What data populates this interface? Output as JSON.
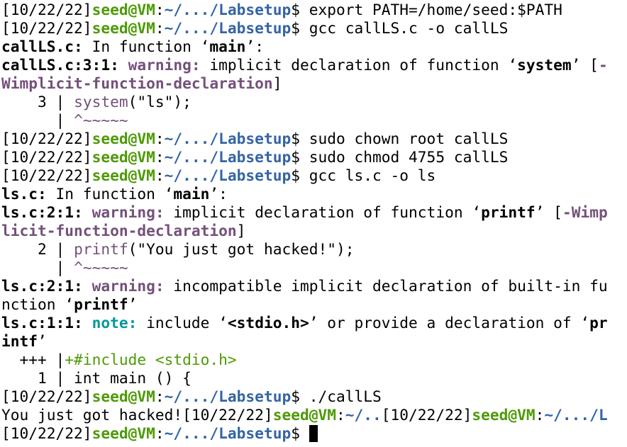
{
  "prompt": {
    "date": "[10/22/22]",
    "user": "seed@VM",
    "colon": ":",
    "path": "~/.../Labsetup",
    "dollar": "$ "
  },
  "lines": [
    {
      "type": "prompt",
      "cmd": "export PATH=/home/seed:$PATH"
    },
    {
      "type": "prompt",
      "cmd": "gcc callLS.c -o callLS"
    },
    {
      "type": "text",
      "segments": [
        {
          "t": "callLS.c:",
          "c": "b"
        },
        {
          "t": " In function ‘",
          "c": ""
        },
        {
          "t": "main",
          "c": "b"
        },
        {
          "t": "’:",
          "c": ""
        }
      ]
    },
    {
      "type": "text",
      "segments": [
        {
          "t": "callLS.c:3:1:",
          "c": "b"
        },
        {
          "t": " ",
          "c": ""
        },
        {
          "t": "warning:",
          "c": "warn"
        },
        {
          "t": " implicit declaration of function ‘",
          "c": ""
        },
        {
          "t": "system",
          "c": "b"
        },
        {
          "t": "’ [",
          "c": ""
        },
        {
          "t": "-",
          "c": "warn"
        }
      ]
    },
    {
      "type": "text",
      "segments": [
        {
          "t": "Wimplicit-function-declaration",
          "c": "warn"
        },
        {
          "t": "]",
          "c": ""
        }
      ]
    },
    {
      "type": "text",
      "segments": [
        {
          "t": "    3 | ",
          "c": ""
        },
        {
          "t": "system",
          "c": "purple"
        },
        {
          "t": "(\"ls\");",
          "c": ""
        }
      ]
    },
    {
      "type": "text",
      "segments": [
        {
          "t": "      | ",
          "c": ""
        },
        {
          "t": "^~~~~~",
          "c": "purple"
        }
      ]
    },
    {
      "type": "prompt",
      "cmd": "sudo chown root callLS"
    },
    {
      "type": "prompt",
      "cmd": "sudo chmod 4755 callLS"
    },
    {
      "type": "prompt",
      "cmd": "gcc ls.c -o ls"
    },
    {
      "type": "text",
      "segments": [
        {
          "t": "ls.c:",
          "c": "b"
        },
        {
          "t": " In function ‘",
          "c": ""
        },
        {
          "t": "main",
          "c": "b"
        },
        {
          "t": "’:",
          "c": ""
        }
      ]
    },
    {
      "type": "text",
      "segments": [
        {
          "t": "ls.c:2:1:",
          "c": "b"
        },
        {
          "t": " ",
          "c": ""
        },
        {
          "t": "warning:",
          "c": "warn"
        },
        {
          "t": " implicit declaration of function ‘",
          "c": ""
        },
        {
          "t": "printf",
          "c": "b"
        },
        {
          "t": "’ [",
          "c": ""
        },
        {
          "t": "-Wimp",
          "c": "warn"
        }
      ]
    },
    {
      "type": "text",
      "segments": [
        {
          "t": "licit-function-declaration",
          "c": "warn"
        },
        {
          "t": "]",
          "c": ""
        }
      ]
    },
    {
      "type": "text",
      "segments": [
        {
          "t": "    2 | ",
          "c": ""
        },
        {
          "t": "printf",
          "c": "purple"
        },
        {
          "t": "(\"You just got hacked!\");",
          "c": ""
        }
      ]
    },
    {
      "type": "text",
      "segments": [
        {
          "t": "      | ",
          "c": ""
        },
        {
          "t": "^~~~~~",
          "c": "purple"
        }
      ]
    },
    {
      "type": "text",
      "segments": [
        {
          "t": "ls.c:2:1:",
          "c": "b"
        },
        {
          "t": " ",
          "c": ""
        },
        {
          "t": "warning:",
          "c": "warn"
        },
        {
          "t": " incompatible implicit declaration of built-in fu",
          "c": ""
        }
      ]
    },
    {
      "type": "text",
      "segments": [
        {
          "t": "nction ‘",
          "c": ""
        },
        {
          "t": "printf",
          "c": "b"
        },
        {
          "t": "’",
          "c": ""
        }
      ]
    },
    {
      "type": "text",
      "segments": [
        {
          "t": "ls.c:1:1:",
          "c": "b"
        },
        {
          "t": " ",
          "c": ""
        },
        {
          "t": "note:",
          "c": "teal"
        },
        {
          "t": " include ‘",
          "c": ""
        },
        {
          "t": "<stdio.h>",
          "c": "b"
        },
        {
          "t": "’ or provide a declaration of ‘",
          "c": ""
        },
        {
          "t": "pr",
          "c": "b"
        }
      ]
    },
    {
      "type": "text",
      "segments": [
        {
          "t": "intf",
          "c": "b"
        },
        {
          "t": "’",
          "c": ""
        }
      ]
    },
    {
      "type": "text",
      "segments": [
        {
          "t": "  +++ |",
          "c": ""
        },
        {
          "t": "+#include <stdio.h>",
          "c": "fixit"
        }
      ]
    },
    {
      "type": "text",
      "segments": [
        {
          "t": "    1 | int main () {",
          "c": ""
        }
      ]
    },
    {
      "type": "prompt",
      "cmd": "./callLS"
    },
    {
      "type": "text",
      "segments": [
        {
          "t": "You just got hacked![10/22/22]",
          "c": ""
        },
        {
          "t": "seed@VM",
          "c": "green"
        },
        {
          "t": ":",
          "c": ""
        },
        {
          "t": "~/..",
          "c": "blue"
        },
        {
          "t": "[10/22/22]",
          "c": ""
        },
        {
          "t": "seed@VM",
          "c": "green"
        },
        {
          "t": ":",
          "c": ""
        },
        {
          "t": "~/.../L",
          "c": "blue"
        }
      ]
    },
    {
      "type": "prompt",
      "cmd": "",
      "cursor": true
    }
  ]
}
